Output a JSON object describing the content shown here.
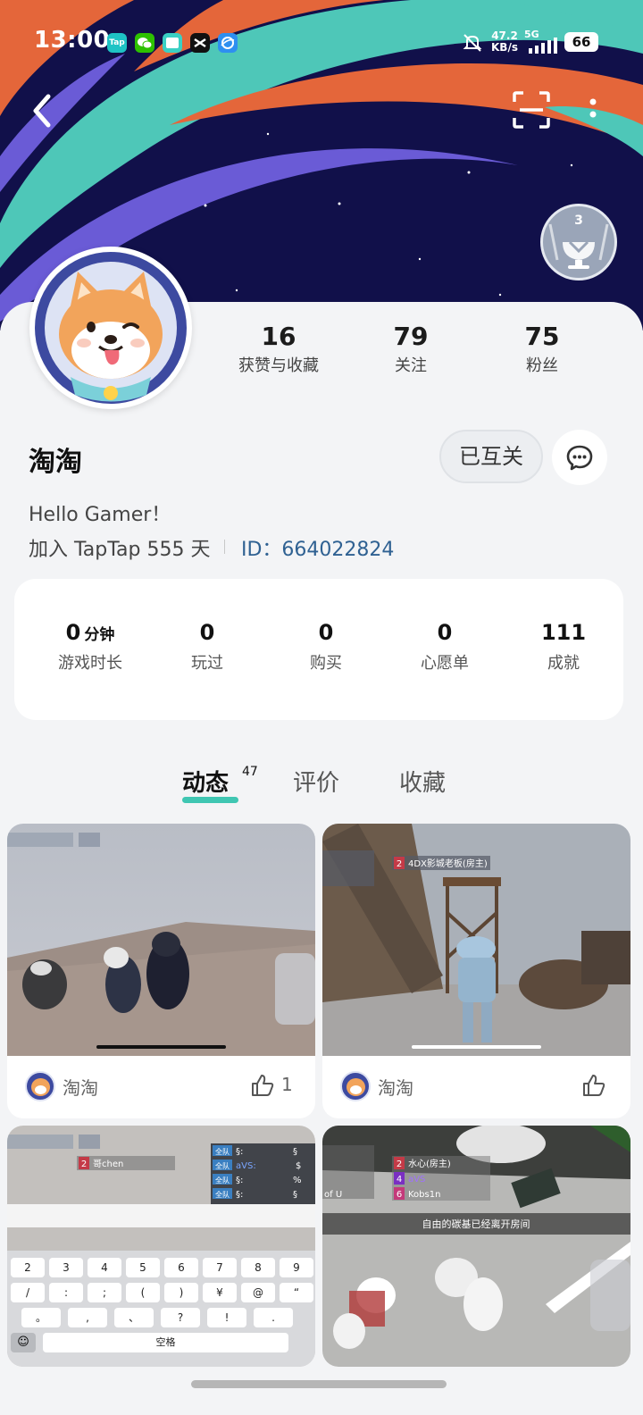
{
  "status_bar": {
    "time": "13:00",
    "apps": [
      "Tap",
      "wechat-icon",
      "window-icon",
      "capcut-icon",
      "browser-icon"
    ],
    "net_speed_value": "47.2",
    "net_speed_unit": "KB/s",
    "network": "5G",
    "battery": "66"
  },
  "profile": {
    "achievement_badge_level": "3",
    "stats": [
      {
        "value": "16",
        "label": "获赞与收藏"
      },
      {
        "value": "79",
        "label": "关注"
      },
      {
        "value": "75",
        "label": "粉丝"
      }
    ],
    "name": "淘淘",
    "follow_status": "已互关",
    "bio": "Hello Gamer！",
    "join_text": "加入 TapTap 555 天",
    "id_text": "ID：664022824"
  },
  "game_stats": [
    {
      "value": "0",
      "unit": "分钟",
      "label": "游戏时长"
    },
    {
      "value": "0",
      "unit": "",
      "label": "玩过"
    },
    {
      "value": "0",
      "unit": "",
      "label": "购买"
    },
    {
      "value": "0",
      "unit": "",
      "label": "心愿单"
    },
    {
      "value": "111",
      "unit": "",
      "label": "成就"
    }
  ],
  "tabs": [
    {
      "label": "动态",
      "count": "47",
      "active": true
    },
    {
      "label": "评价",
      "active": false
    },
    {
      "label": "收藏",
      "active": false
    }
  ],
  "posts": [
    {
      "author": "淘淘",
      "likes": "1"
    },
    {
      "author": "淘淘",
      "likes": "",
      "overlay_names": [
        "4DX影城老板(房主)"
      ],
      "player_num": "2"
    },
    {
      "author": "",
      "likes": "",
      "overlay_names": [
        "哥chen"
      ],
      "player_num": "2",
      "team_label": "全队",
      "team_rows": [
        "§:",
        "aVS:",
        "§:",
        "§:"
      ],
      "team_values": [
        "§",
        "$",
        "%",
        "§"
      ],
      "keys_row1": [
        "2",
        "3",
        "4",
        "5",
        "6",
        "7",
        "8",
        "9"
      ],
      "keys_row2": [
        "/",
        ":",
        ";",
        "(",
        ")",
        "¥",
        "@",
        "“"
      ],
      "keys_row3": [
        "。",
        ",",
        "、",
        "?",
        "!",
        "."
      ],
      "space_label": "空格"
    },
    {
      "author": "",
      "likes": "",
      "overlay_names": [
        "水心(房主)",
        "aVS",
        "Kobs1n"
      ],
      "player_nums": [
        "2",
        "4",
        "6"
      ],
      "side_label": "of U",
      "notice": "自由的碳基已经离开房间"
    }
  ],
  "colors": {
    "accent": "#3fc6b2",
    "id_blue": "#2f6192",
    "banner_navy": "#11104a",
    "stripe_orange": "#e4663a",
    "stripe_teal": "#4ec7b8",
    "stripe_purple": "#6a5bd6"
  }
}
